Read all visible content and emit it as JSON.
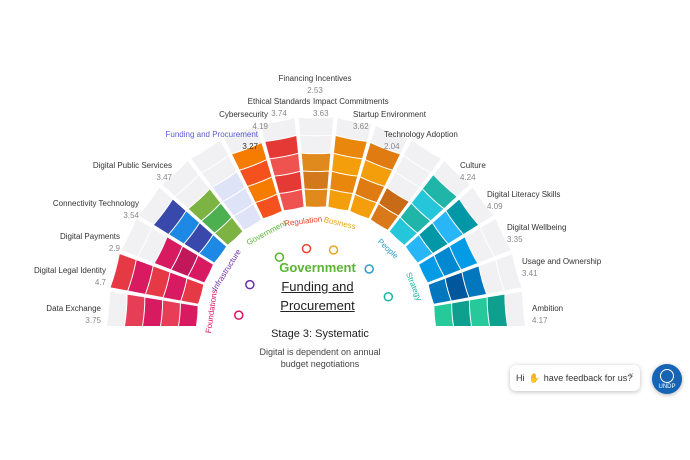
{
  "center": {
    "pillar_name": "Government",
    "selected_line1": "Funding and",
    "selected_line2": "Procurement",
    "stage_title": "Stage 3: Systematic",
    "stage_desc_line1": "Digital is dependent on annual",
    "stage_desc_line2": "budget negotiations"
  },
  "pillars": [
    {
      "name": "Foundations",
      "color": "#d8135f"
    },
    {
      "name": "Infrastructure",
      "color": "#6a2fa8"
    },
    {
      "name": "Government",
      "color": "#5ab533"
    },
    {
      "name": "Regulation",
      "color": "#e8452a"
    },
    {
      "name": "Business",
      "color": "#e6a617"
    },
    {
      "name": "People",
      "color": "#2a9fc7"
    },
    {
      "name": "Strategy",
      "color": "#14b8a6"
    }
  ],
  "indicators": [
    {
      "name": "Data Exchange",
      "value": "3.75",
      "color": "#d81b60",
      "color2": "#e83d57",
      "level": 3.75
    },
    {
      "name": "Digital Legal Identity",
      "value": "4.7",
      "color": "#e63946",
      "color2": "#d81b60",
      "level": 4.7
    },
    {
      "name": "Digital Payments",
      "value": "2.9",
      "color": "#d81b60",
      "color2": "#c2185b",
      "level": 2.9
    },
    {
      "name": "Connectivity Technology",
      "value": "3.54",
      "color": "#1e88e5",
      "color2": "#3949ab",
      "level": 3.54
    },
    {
      "name": "Digital Public Services",
      "value": "3.47",
      "color": "#7cb342",
      "color2": "#4caf50",
      "level": 3.47
    },
    {
      "name": "Funding and Procurement",
      "value": "3.27",
      "color": "#dfe3f7",
      "color2": "#dfe3f7",
      "level": 3.27
    },
    {
      "name": "Cybersecurity",
      "value": "4.19",
      "color": "#f4511e",
      "color2": "#f57c00",
      "level": 4.19
    },
    {
      "name": "Ethical Standards",
      "value": "3.74",
      "color": "#ef5350",
      "color2": "#e53935",
      "level": 3.74
    },
    {
      "name": "Financing Incentives",
      "value": "2.53",
      "color": "#e08a1e",
      "color2": "#d4791b",
      "level": 2.53
    },
    {
      "name": "Impact Commitments",
      "value": "3.63",
      "color": "#f59e0b",
      "color2": "#e8870b",
      "level": 3.63
    },
    {
      "name": "Startup Environment",
      "value": "3.62",
      "color": "#f59e0b",
      "color2": "#e07b12",
      "level": 3.62
    },
    {
      "name": "Technology Adoption",
      "value": "2.04",
      "color": "#d9791a",
      "color2": "#c96a16",
      "level": 2.04
    },
    {
      "name": "Culture",
      "value": "4.24",
      "color": "#26c6da",
      "color2": "#1fb5a8",
      "level": 4.24
    },
    {
      "name": "Digital Literacy Skills",
      "value": "4.09",
      "color": "#29b6f6",
      "color2": "#0097a7",
      "level": 4.09
    },
    {
      "name": "Digital Wellbeing",
      "value": "3.35",
      "color": "#039be5",
      "color2": "#0288d1",
      "level": 3.35
    },
    {
      "name": "Usage and Ownership",
      "value": "3.41",
      "color": "#0277bd",
      "color2": "#01579b",
      "level": 3.41
    },
    {
      "name": "Ambition",
      "value": "4.17",
      "color": "#26c99a",
      "color2": "#0e9f8f",
      "level": 4.17
    }
  ],
  "feedback": {
    "hi": "Hi",
    "wave_icon": "waving-hand-icon",
    "text": "have feedback for us?",
    "close": "×"
  },
  "logo": {
    "text": "UNDP"
  }
}
